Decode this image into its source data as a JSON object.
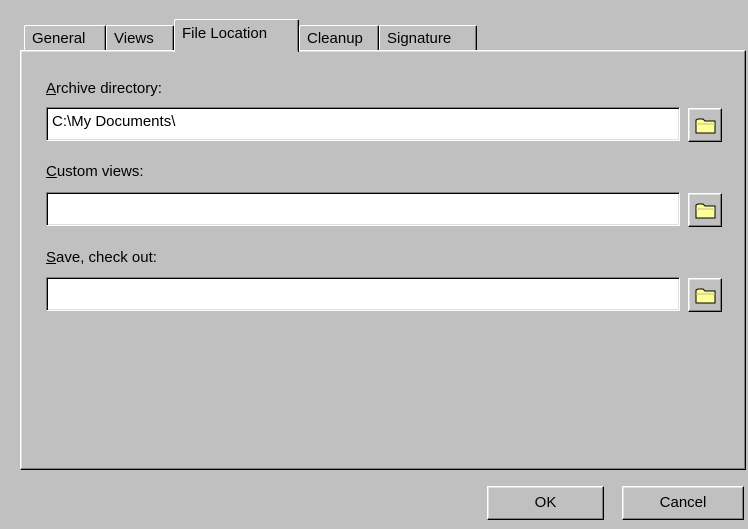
{
  "tabs": [
    {
      "label": "General"
    },
    {
      "label": "Views"
    },
    {
      "label": "File Location",
      "active": true
    },
    {
      "label": "Cleanup"
    },
    {
      "label": "Signature"
    }
  ],
  "fields": {
    "archive": {
      "label": "Archive directory:",
      "value": "C:\\My Documents\\"
    },
    "custom_views": {
      "label": "Custom views:",
      "value": ""
    },
    "save_checkout": {
      "label": "Save, check out:",
      "value": ""
    }
  },
  "buttons": {
    "ok": "OK",
    "cancel": "Cancel"
  },
  "icons": {
    "browse": "folder-icon",
    "folder_fill": "#ffff99",
    "folder_shade": "#c0c080"
  }
}
